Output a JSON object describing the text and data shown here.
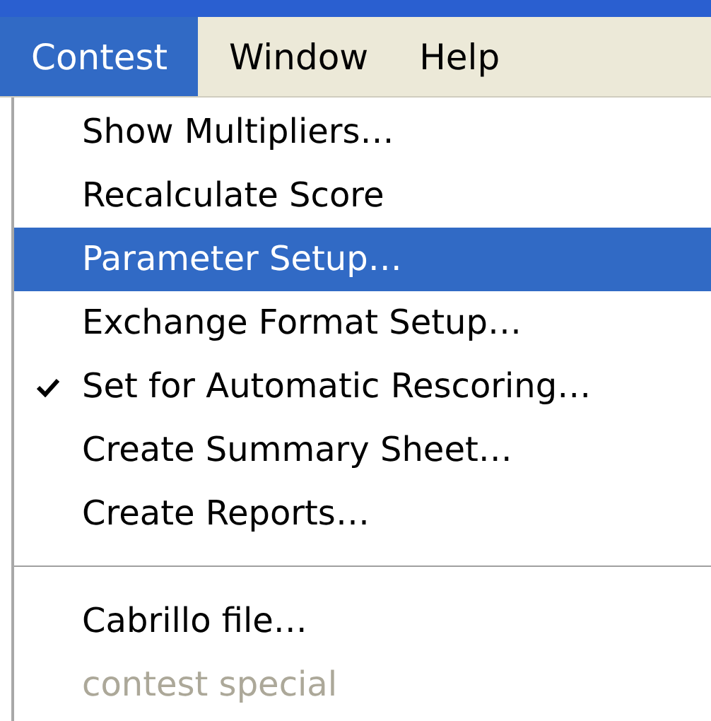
{
  "menubar": [
    {
      "label": "Contest",
      "selected": true
    },
    {
      "label": "Window",
      "selected": false
    },
    {
      "label": "Help",
      "selected": false
    }
  ],
  "menu": [
    {
      "kind": "item",
      "label": "Show Multipliers…",
      "selected": false,
      "checked": false,
      "disabled": false
    },
    {
      "kind": "item",
      "label": "Recalculate Score",
      "selected": false,
      "checked": false,
      "disabled": false
    },
    {
      "kind": "item",
      "label": "Parameter Setup…",
      "selected": true,
      "checked": false,
      "disabled": false
    },
    {
      "kind": "item",
      "label": "Exchange Format Setup…",
      "selected": false,
      "checked": false,
      "disabled": false
    },
    {
      "kind": "item",
      "label": "Set for Automatic Rescoring…",
      "selected": false,
      "checked": true,
      "disabled": false
    },
    {
      "kind": "item",
      "label": "Create Summary Sheet…",
      "selected": false,
      "checked": false,
      "disabled": false
    },
    {
      "kind": "item",
      "label": "Create Reports…",
      "selected": false,
      "checked": false,
      "disabled": false
    },
    {
      "kind": "separator"
    },
    {
      "kind": "item",
      "label": "Cabrillo file…",
      "selected": false,
      "checked": false,
      "disabled": false
    },
    {
      "kind": "item",
      "label": "contest special",
      "selected": false,
      "checked": false,
      "disabled": true
    }
  ]
}
